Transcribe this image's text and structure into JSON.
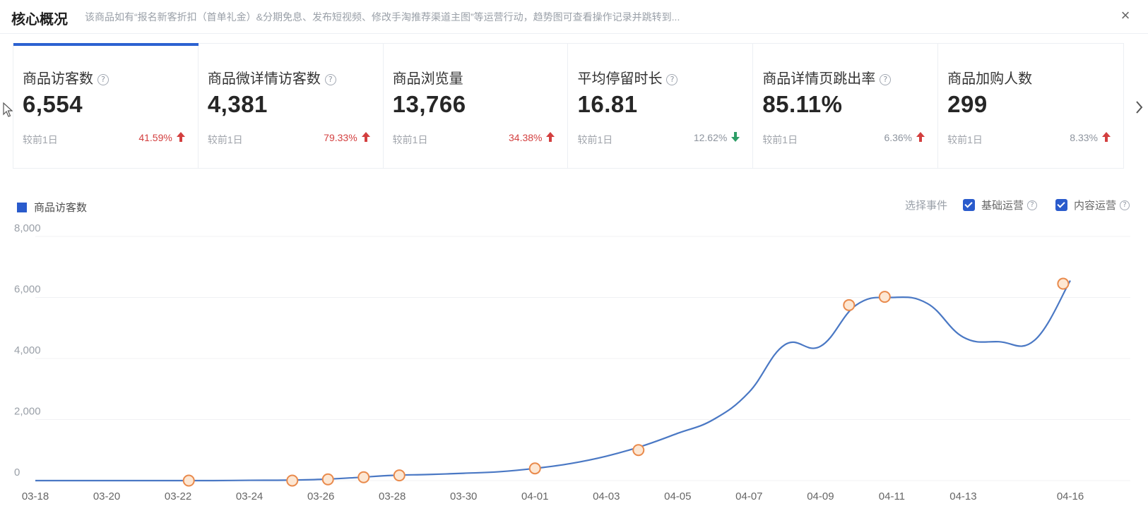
{
  "header": {
    "title": "核心概况",
    "description": "该商品如有“报名新客折扣（首单礼金）&分期免息、发布短视频、修改手淘推荐渠道主图”等运营行动，趋势图可查看操作记录并跳转到...",
    "close_glyph": "×"
  },
  "metrics": [
    {
      "label": "商品访客数",
      "help": true,
      "value": "6,554",
      "compare": "较前1日",
      "change": "41.59%",
      "trend": "up"
    },
    {
      "label": "商品微详情访客数",
      "help": true,
      "value": "4,381",
      "compare": "较前1日",
      "change": "79.33%",
      "trend": "up"
    },
    {
      "label": "商品浏览量",
      "help": false,
      "value": "13,766",
      "compare": "较前1日",
      "change": "34.38%",
      "trend": "up"
    },
    {
      "label": "平均停留时长",
      "help": true,
      "value": "16.81",
      "compare": "较前1日",
      "change": "12.62%",
      "trend": "down"
    },
    {
      "label": "商品详情页跳出率",
      "help": true,
      "value": "85.11%",
      "compare": "较前1日",
      "change": "6.36%",
      "trend": "up"
    },
    {
      "label": "商品加购人数",
      "help": false,
      "value": "299",
      "compare": "较前1日",
      "change": "8.33%",
      "trend": "up"
    }
  ],
  "colors": {
    "accent": "#2a5bcc",
    "line": "#4a78c4",
    "up": "#d33f3f",
    "down": "#2e9e67",
    "event_fill": "#fde7d3",
    "event_stroke": "#e98a4c"
  },
  "chart_controls": {
    "legend": "商品访客数",
    "events_label": "选择事件",
    "events": [
      {
        "label": "基础运营",
        "checked": true
      },
      {
        "label": "内容运营",
        "checked": true
      }
    ]
  },
  "chart_data": {
    "type": "line",
    "x_start": "03-18",
    "x_labels": [
      "03-18",
      "03-20",
      "03-22",
      "03-24",
      "03-26",
      "03-28",
      "03-30",
      "04-01",
      "04-03",
      "04-05",
      "04-07",
      "04-09",
      "04-11",
      "04-13",
      "04-16"
    ],
    "ylim": [
      0,
      8000
    ],
    "y_ticks": [
      0,
      2000,
      4000,
      6000,
      8000
    ],
    "y_tick_labels": [
      "0",
      "2,000",
      "4,000",
      "6,000",
      "8,000"
    ],
    "grid": true,
    "series": [
      {
        "name": "商品访客数",
        "values": [
          {
            "x": 0,
            "y": 0
          },
          {
            "x": 1,
            "y": 0
          },
          {
            "x": 2,
            "y": 0
          },
          {
            "x": 3,
            "y": 0
          },
          {
            "x": 4,
            "y": 0
          },
          {
            "x": 5,
            "y": 0
          },
          {
            "x": 6,
            "y": 10
          },
          {
            "x": 7,
            "y": 15
          },
          {
            "x": 8,
            "y": 40
          },
          {
            "x": 9,
            "y": 100
          },
          {
            "x": 10,
            "y": 170
          },
          {
            "x": 11,
            "y": 200
          },
          {
            "x": 12,
            "y": 240
          },
          {
            "x": 13,
            "y": 290
          },
          {
            "x": 14,
            "y": 400
          },
          {
            "x": 15,
            "y": 560
          },
          {
            "x": 16,
            "y": 800
          },
          {
            "x": 17,
            "y": 1130
          },
          {
            "x": 18,
            "y": 1550
          },
          {
            "x": 19,
            "y": 2000
          },
          {
            "x": 20,
            "y": 2900
          },
          {
            "x": 21,
            "y": 4450
          },
          {
            "x": 22,
            "y": 4400
          },
          {
            "x": 23,
            "y": 5750
          },
          {
            "x": 24,
            "y": 6000
          },
          {
            "x": 25,
            "y": 5800
          },
          {
            "x": 26,
            "y": 4700
          },
          {
            "x": 27,
            "y": 4550
          },
          {
            "x": 28,
            "y": 4600
          },
          {
            "x": 29,
            "y": 6554
          }
        ]
      }
    ],
    "events": [
      {
        "x": 4.3,
        "y": 0
      },
      {
        "x": 7.2,
        "y": 0
      },
      {
        "x": 8.2,
        "y": 40
      },
      {
        "x": 9.2,
        "y": 110
      },
      {
        "x": 10.2,
        "y": 170
      },
      {
        "x": 14.0,
        "y": 400
      },
      {
        "x": 16.9,
        "y": 1000
      },
      {
        "x": 22.8,
        "y": 5750
      },
      {
        "x": 23.8,
        "y": 6020
      },
      {
        "x": 28.8,
        "y": 6450
      }
    ]
  }
}
